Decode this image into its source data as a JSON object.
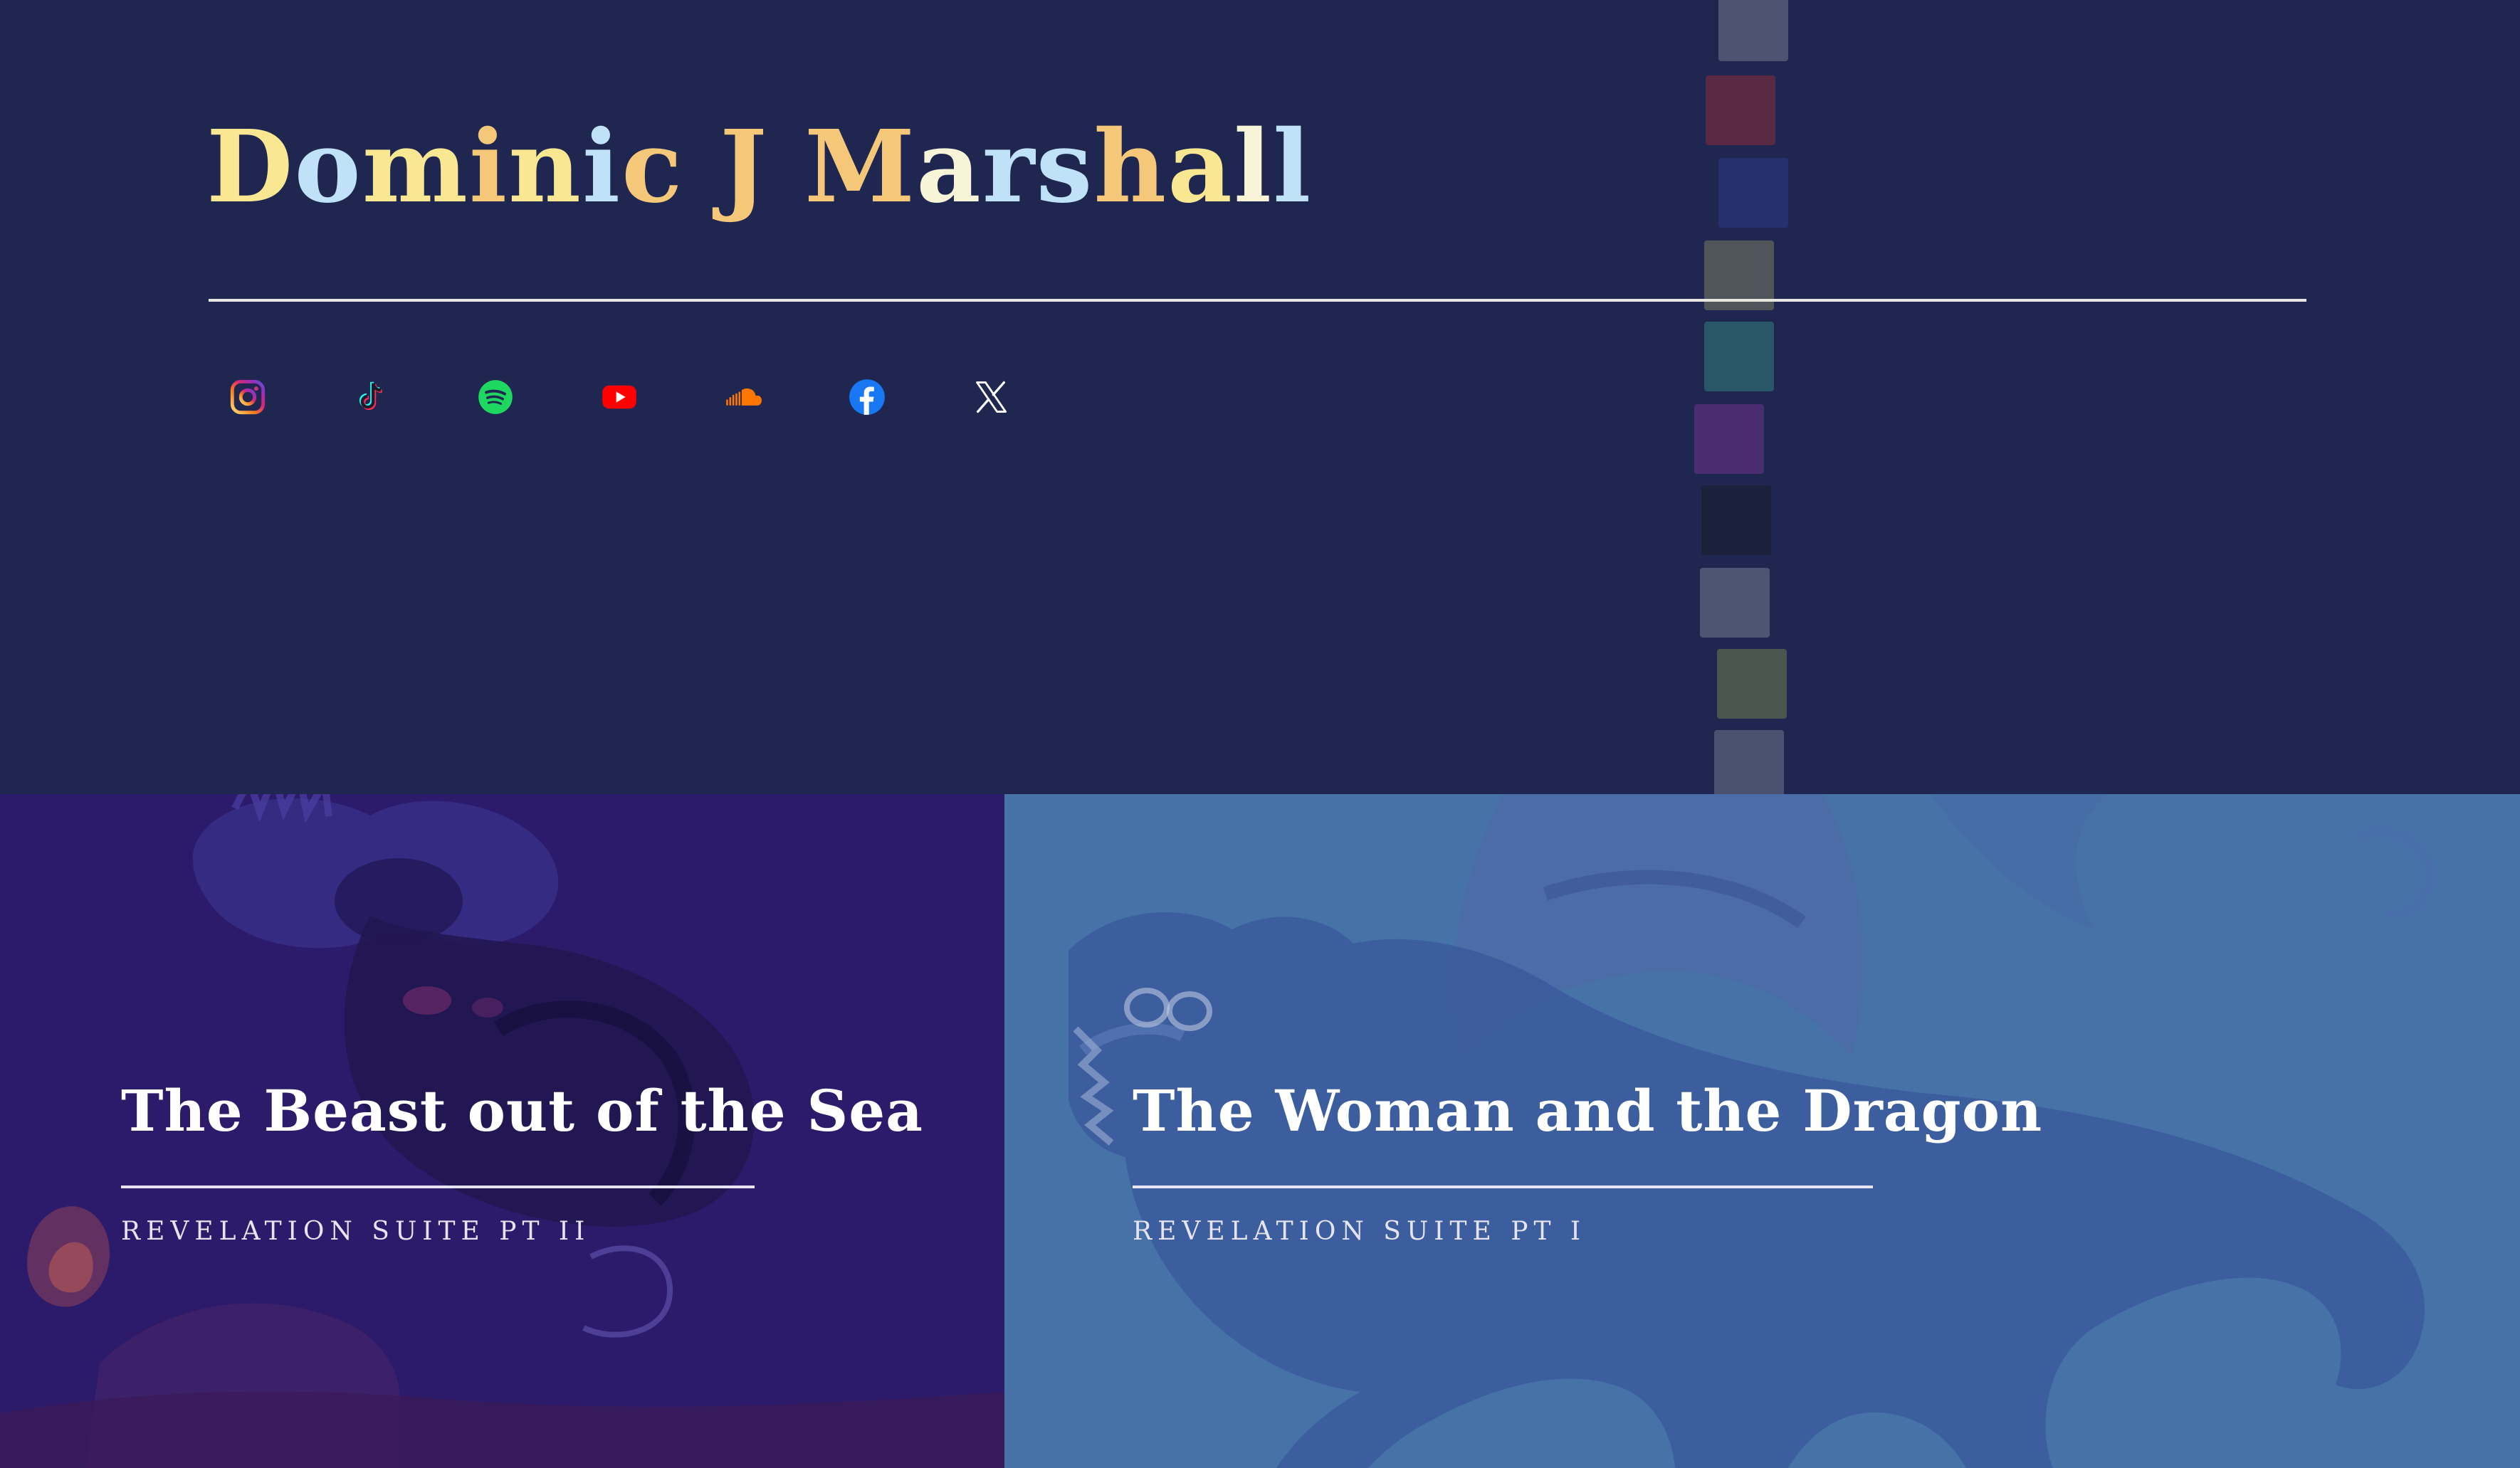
{
  "site": {
    "title": "Dominic J Marshall"
  },
  "social": [
    {
      "name": "instagram",
      "icon": "instagram-icon",
      "color": "#e1306c"
    },
    {
      "name": "tiktok",
      "icon": "tiktok-icon",
      "color": "#25f4ee"
    },
    {
      "name": "spotify",
      "icon": "spotify-icon",
      "color": "#1ed760"
    },
    {
      "name": "youtube",
      "icon": "youtube-icon",
      "color": "#ff0000"
    },
    {
      "name": "soundcloud",
      "icon": "soundcloud-icon",
      "color": "#ff7700"
    },
    {
      "name": "facebook",
      "icon": "facebook-icon",
      "color": "#1877f2"
    },
    {
      "name": "x",
      "icon": "x-icon",
      "color": "#ffffff"
    }
  ],
  "releases": [
    {
      "title": "The Beast out of the Sea",
      "subtitle": "REVELATION SUITE PT II"
    },
    {
      "title": "The Woman and the Dragon",
      "subtitle": "REVELATION SUITE PT I"
    }
  ],
  "colors": {
    "background": "#1f2751",
    "title_yellow": "#f9e891",
    "title_blue": "#bfe2f8",
    "card_1": "#2c1b6b",
    "card_2": "#4672a8"
  }
}
